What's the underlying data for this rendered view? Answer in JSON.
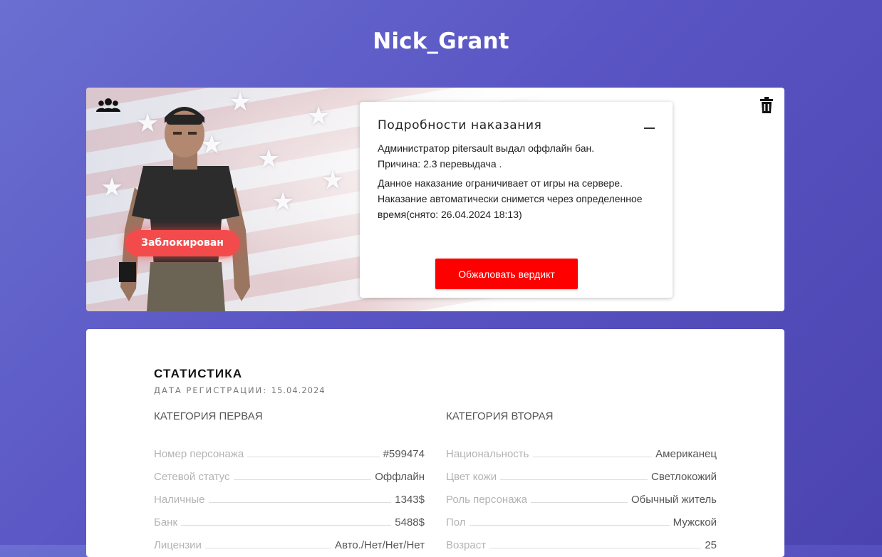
{
  "page": {
    "title": "Nick_Grant"
  },
  "profile": {
    "status_badge": "Заблокирован",
    "icons": {
      "group": "users-group-icon",
      "delete": "trash-icon"
    },
    "colors": {
      "badge": "#f34b4b",
      "appeal_button": "#fe0000"
    }
  },
  "punishment": {
    "title": "Подробности наказания",
    "line1": "Администратор pitersault выдал оффлайн бан.",
    "line2": "Причина: 2.3 перевыдача .",
    "line3": "Данное наказание ограничивает от игры на сервере. Наказание автоматически снимется через определенное время(снято: 26.04.2024 18:13)",
    "appeal_label": "Обжаловать вердикт"
  },
  "stats": {
    "title": "СТАТИСТИКА",
    "reg_label": "ДАТА РЕГИСТРАЦИИ:",
    "reg_value": "15.04.2024",
    "cat1": {
      "header": "КАТЕГОРИЯ ПЕРВАЯ",
      "rows": [
        {
          "label": "Номер персонажа",
          "value": "#599474"
        },
        {
          "label": "Сетевой статус",
          "value": "Оффлайн"
        },
        {
          "label": "Наличные",
          "value": "1343$"
        },
        {
          "label": "Банк",
          "value": "5488$"
        },
        {
          "label": "Лицензии",
          "value": "Авто./Нет/Нет/Нет"
        }
      ]
    },
    "cat2": {
      "header": "КАТЕГОРИЯ ВТОРАЯ",
      "rows": [
        {
          "label": "Национальность",
          "value": "Американец"
        },
        {
          "label": "Цвет кожи",
          "value": "Светлокожий"
        },
        {
          "label": "Роль персонажа",
          "value": "Обычный житель"
        },
        {
          "label": "Пол",
          "value": "Мужской"
        },
        {
          "label": "Возраст",
          "value": "25"
        }
      ]
    }
  }
}
